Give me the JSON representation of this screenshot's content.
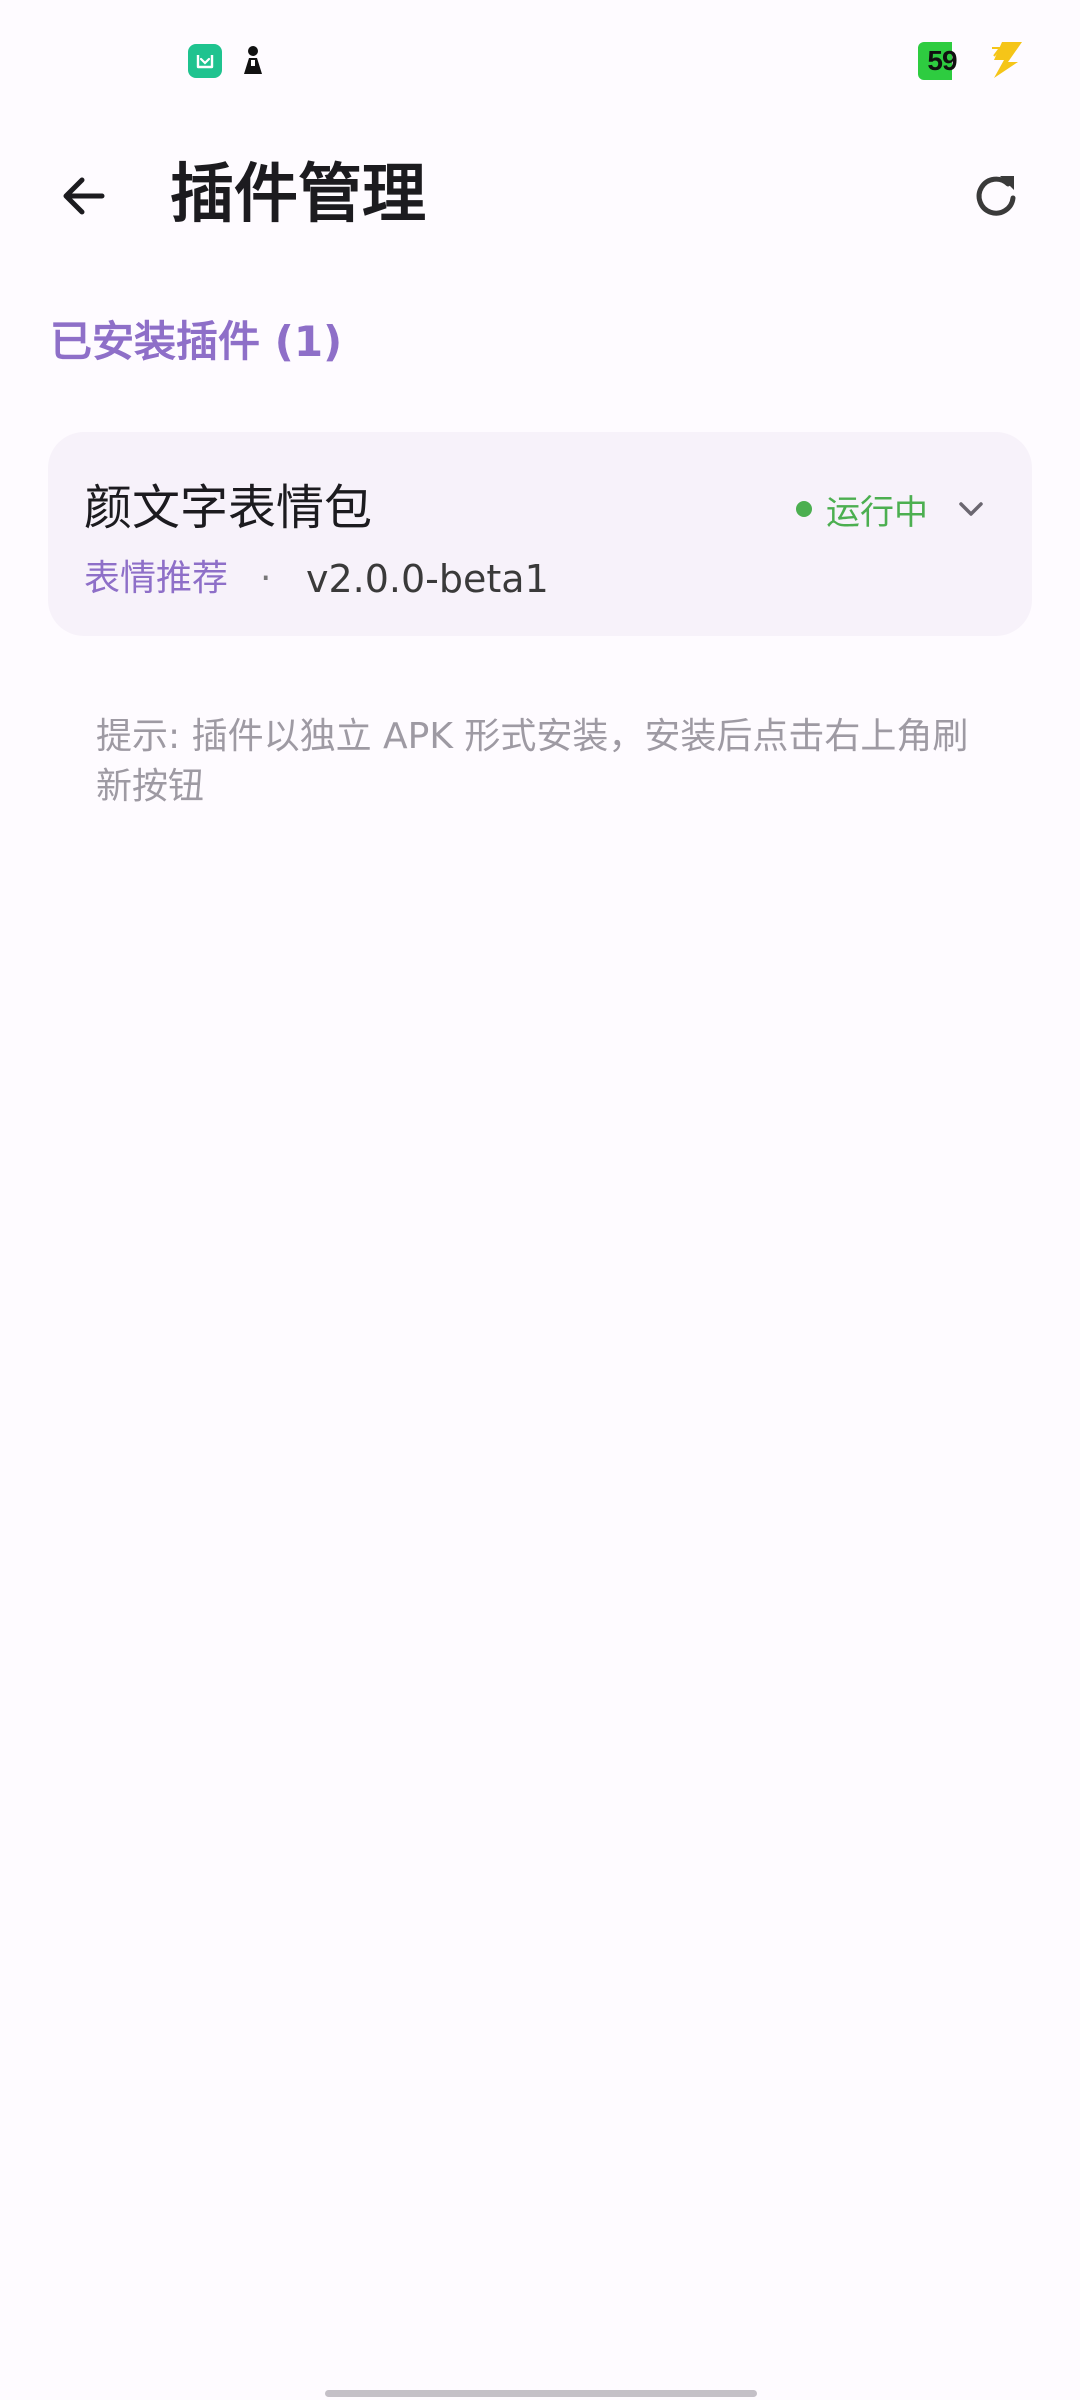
{
  "status_bar": {
    "battery_level": "59",
    "icons": [
      "mi-home-icon",
      "figure-icon",
      "charging-icon"
    ],
    "battery_color": "#2ecc40"
  },
  "app_bar": {
    "title": "插件管理",
    "back_icon": "arrow-back-icon",
    "refresh_icon": "refresh-icon"
  },
  "section": {
    "header": "已安装插件 (1)"
  },
  "plugins": [
    {
      "name": "颜文字表情包",
      "category": "表情推荐",
      "separator": "·",
      "version": "v2.0.0-beta1",
      "status": "运行中",
      "status_color": "#4caf50"
    }
  ],
  "hint": "提示: 插件以独立 APK 形式安装，安装后点击右上角刷新按钮",
  "colors": {
    "accent": "#8e6fc8",
    "card_background": "#f7f2fa",
    "background": "#fefbff",
    "running": "#4caf50"
  }
}
